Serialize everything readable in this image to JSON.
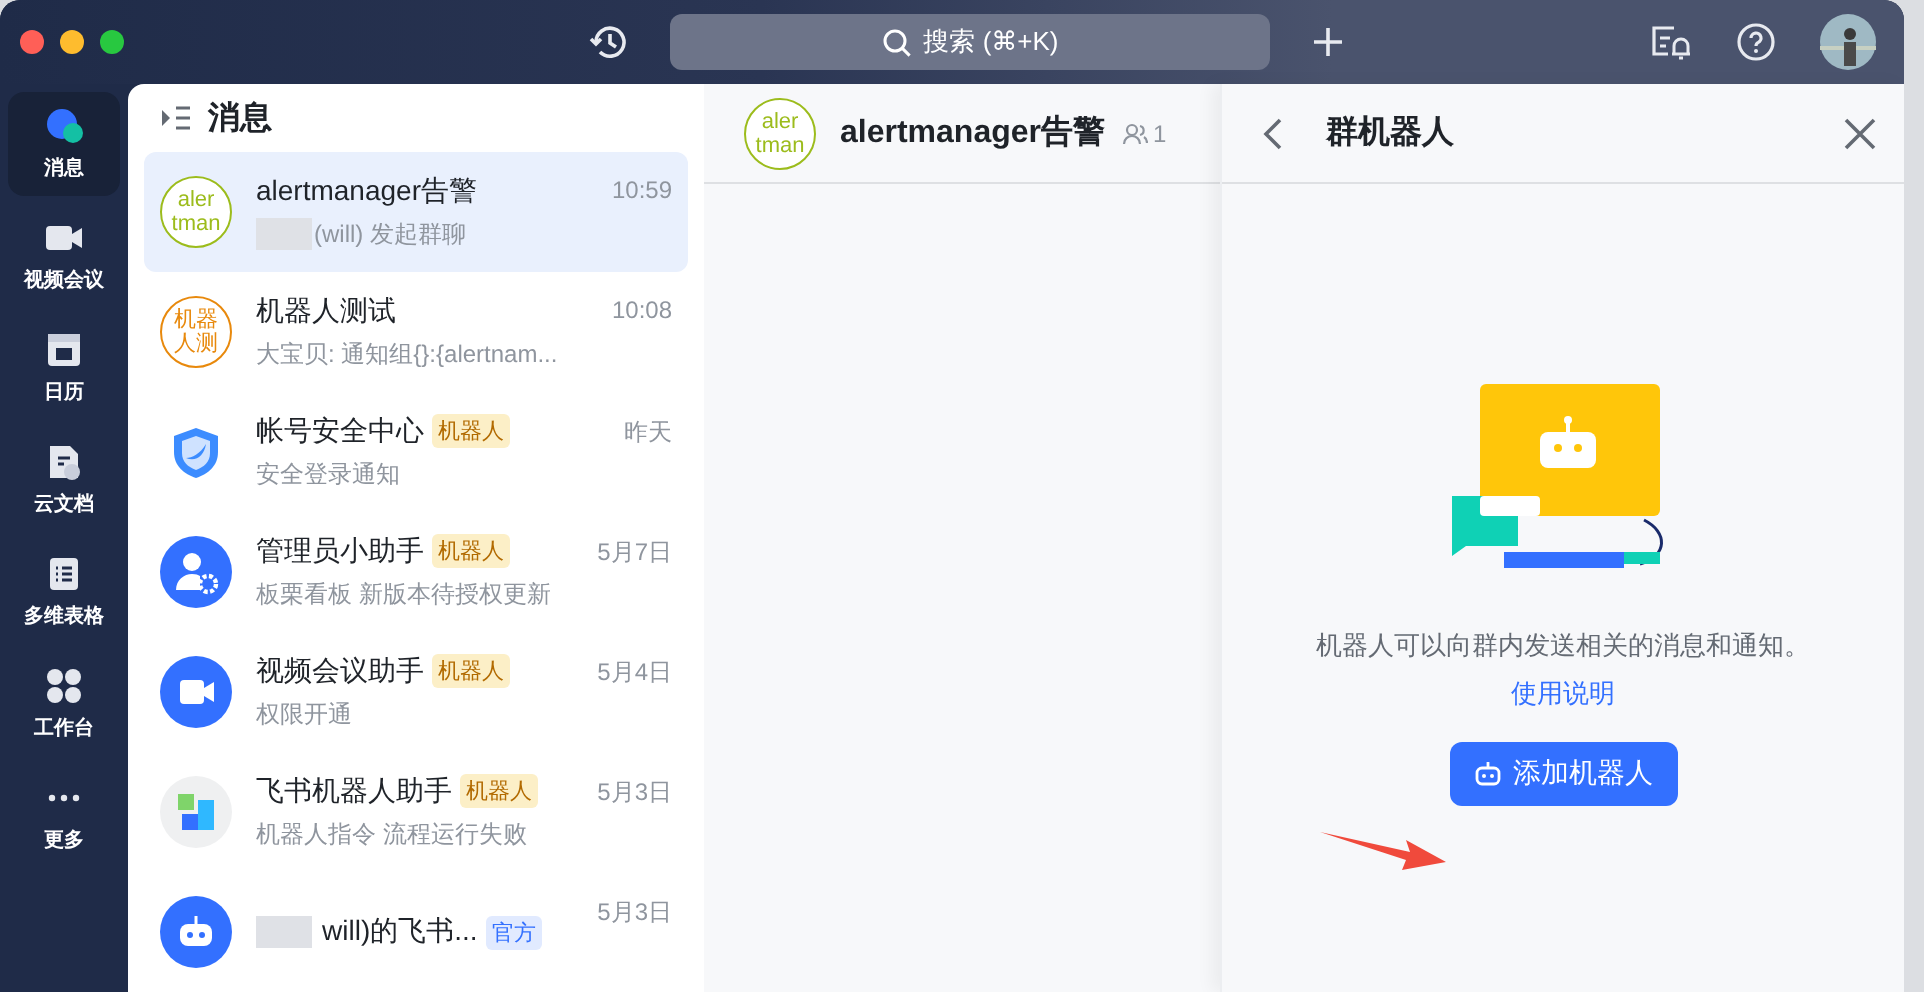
{
  "window": {
    "search_placeholder": "搜索 (⌘+K)"
  },
  "nav": [
    {
      "kind": "chat",
      "label": "消息",
      "selected": true
    },
    {
      "kind": "video",
      "label": "视频会议",
      "selected": false
    },
    {
      "kind": "calendar",
      "label": "日历",
      "selected": false
    },
    {
      "kind": "docs",
      "label": "云文档",
      "selected": false
    },
    {
      "kind": "sheet",
      "label": "多维表格",
      "selected": false
    },
    {
      "kind": "apps",
      "label": "工作台",
      "selected": false
    },
    {
      "kind": "more",
      "label": "更多",
      "selected": false
    }
  ],
  "list": {
    "title": "消息",
    "items": [
      {
        "kind": "text",
        "avatar_lines": [
          "aler",
          "tman"
        ],
        "color": "#9cbc1c",
        "title": "alertmanager告警",
        "time": "10:59",
        "redacted_subtitle": true,
        "subtitle": "(will) 发起群聊",
        "selected": true
      },
      {
        "kind": "text",
        "avatar_lines": [
          "机器",
          "人测"
        ],
        "color": "#e8890c",
        "title": "机器人测试",
        "time": "10:08",
        "subtitle": "大宝贝: 通知组{}:{alertnam...",
        "selected": false
      },
      {
        "kind": "shield",
        "title": "帐号安全中心",
        "tag": {
          "kind": "bot",
          "label": "机器人"
        },
        "time": "昨天",
        "subtitle": "安全登录通知",
        "selected": false
      },
      {
        "kind": "admin",
        "title": "管理员小助手",
        "tag": {
          "kind": "bot",
          "label": "机器人"
        },
        "time": "5月7日",
        "subtitle": "板栗看板 新版本待授权更新",
        "selected": false
      },
      {
        "kind": "video",
        "title": "视频会议助手",
        "tag": {
          "kind": "bot",
          "label": "机器人"
        },
        "time": "5月4日",
        "subtitle": "权限开通",
        "selected": false
      },
      {
        "kind": "blocks",
        "title": "飞书机器人助手",
        "tag": {
          "kind": "bot",
          "label": "机器人"
        },
        "time": "5月3日",
        "subtitle": "机器人指令 流程运行失败",
        "selected": false
      },
      {
        "kind": "robot",
        "redacted_title": true,
        "title": "will)的飞书...",
        "tag": {
          "kind": "official",
          "label": "官方"
        },
        "time": "5月3日",
        "selected": false
      }
    ]
  },
  "chat": {
    "avatar_lines": [
      "aler",
      "tman"
    ],
    "color": "#9cbc1c",
    "title": "alertmanager告警",
    "member_count": "1"
  },
  "panel": {
    "title": "群机器人",
    "description": "机器人可以向群内发送相关的消息和通知。",
    "link": "使用说明",
    "button": "添加机器人"
  }
}
